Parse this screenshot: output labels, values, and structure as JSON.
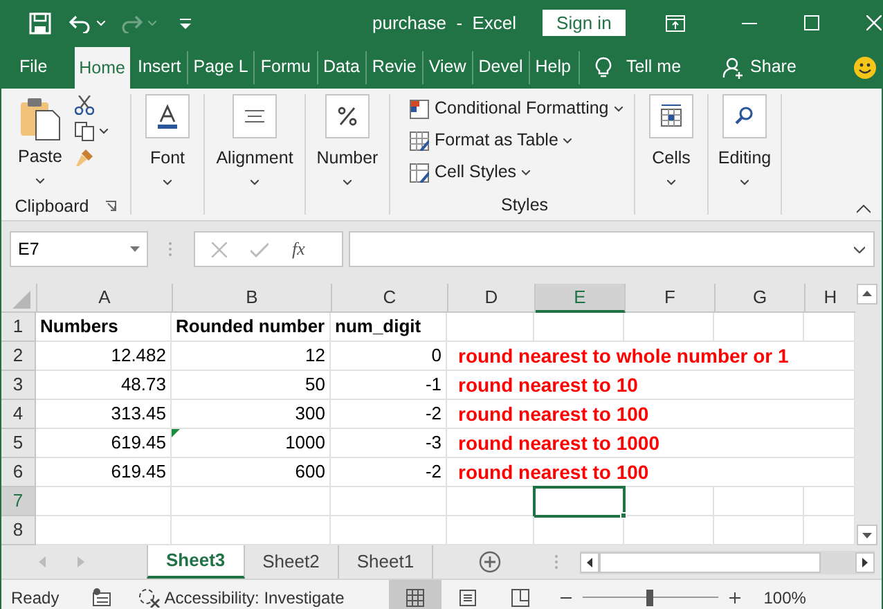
{
  "title_bar": {
    "title": "purchase  -  Excel",
    "sign_in": "Sign in"
  },
  "ribbon_tabs": [
    {
      "label": "File",
      "selected": false
    },
    {
      "label": "Home",
      "selected": true
    },
    {
      "label": "Insert",
      "selected": false
    },
    {
      "label": "Page L",
      "selected": false
    },
    {
      "label": "Formu",
      "selected": false
    },
    {
      "label": "Data",
      "selected": false
    },
    {
      "label": "Revie",
      "selected": false
    },
    {
      "label": "View",
      "selected": false
    },
    {
      "label": "Devel",
      "selected": false
    },
    {
      "label": "Help",
      "selected": false
    }
  ],
  "tell_me": "Tell me",
  "share": "Share",
  "ribbon": {
    "clipboard": {
      "paste": "Paste",
      "label": "Clipboard"
    },
    "big_buttons": [
      {
        "label": "Font",
        "kind": "font"
      },
      {
        "label": "Alignment",
        "kind": "align"
      },
      {
        "label": "Number",
        "kind": "number"
      }
    ],
    "styles": {
      "items": [
        "Conditional Formatting",
        "Format as Table",
        "Cell Styles"
      ],
      "label": "Styles"
    },
    "big_buttons_2": [
      {
        "label": "Cells",
        "kind": "cells"
      },
      {
        "label": "Editing",
        "kind": "editing"
      }
    ]
  },
  "formula_bar": {
    "name_box": "E7",
    "function_button": "fx"
  },
  "columns": [
    {
      "label": "A",
      "selected": false
    },
    {
      "label": "B",
      "selected": false
    },
    {
      "label": "C",
      "selected": false
    },
    {
      "label": "D",
      "selected": false
    },
    {
      "label": "E",
      "selected": true
    },
    {
      "label": "F",
      "selected": false
    },
    {
      "label": "G",
      "selected": false
    },
    {
      "label": "H",
      "selected": false
    }
  ],
  "rows": [
    {
      "number": "1",
      "kind": "header",
      "selected": false,
      "a": "Numbers",
      "b": "Rounded number",
      "c": "num_digit"
    },
    {
      "number": "2",
      "kind": "data",
      "selected": false,
      "a": "12.482",
      "b": "12",
      "c": "0",
      "note": "round nearest to whole number or 1"
    },
    {
      "number": "3",
      "kind": "data",
      "selected": false,
      "a": "48.73",
      "b": "50",
      "c": "-1",
      "note": "round nearest to 10"
    },
    {
      "number": "4",
      "kind": "data",
      "selected": false,
      "a": "313.45",
      "b": "300",
      "c": "-2",
      "note": "round nearest to 100"
    },
    {
      "number": "5",
      "kind": "data",
      "selected": false,
      "a": "619.45",
      "b": "1000",
      "c": "-3",
      "note": "round nearest to 1000",
      "b_error": true
    },
    {
      "number": "6",
      "kind": "data",
      "selected": false,
      "a": "619.45",
      "b": "600",
      "c": "-2",
      "note": "round nearest to 100"
    },
    {
      "number": "7",
      "kind": "empty",
      "selected": true
    },
    {
      "number": "8",
      "kind": "empty",
      "selected": false
    }
  ],
  "sheet_tabs": [
    {
      "label": "Sheet3",
      "selected": true
    },
    {
      "label": "Sheet2",
      "selected": false
    },
    {
      "label": "Sheet1",
      "selected": false
    }
  ],
  "status_bar": {
    "ready": "Ready",
    "accessibility": "Accessibility: Investigate",
    "views": [
      {
        "kind": "normal",
        "selected": true
      },
      {
        "kind": "layout",
        "selected": false
      },
      {
        "kind": "break",
        "selected": false
      }
    ],
    "zoom_slider": {
      "level": 0.5
    },
    "zoom": "100%"
  }
}
